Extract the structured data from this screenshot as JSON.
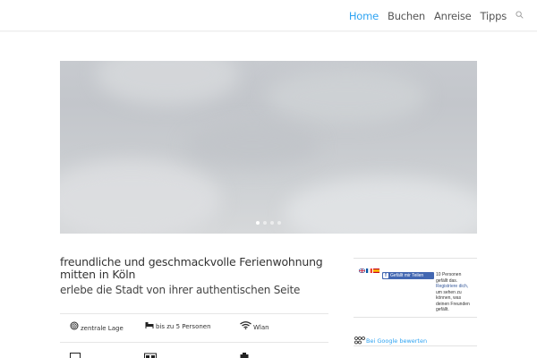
{
  "nav": {
    "items": [
      {
        "label": "Home",
        "active": true
      },
      {
        "label": "Buchen",
        "active": false
      },
      {
        "label": "Anreise",
        "active": false
      },
      {
        "label": "Tipps",
        "active": false
      }
    ],
    "search_icon": "search-icon",
    "active_color": "#2ea3f2"
  },
  "slider": {
    "slide_count": 4,
    "active_slide": 1
  },
  "main": {
    "title": "freundliche und geschmackvolle Ferienwohnung mitten in Köln",
    "subtitle": "erlebe die Stadt von ihrer authentischen Seite",
    "features": [
      {
        "icon": "location-icon",
        "label": "zentrale Lage"
      },
      {
        "icon": "bed-icon",
        "label": "bis zu 5 Personen"
      },
      {
        "icon": "wifi-icon",
        "label": "Wlan"
      }
    ],
    "bottom_icons": [
      "tv-icon",
      "kitchen-icon",
      "bag-icon"
    ]
  },
  "sidebar": {
    "flags": [
      "flag-uk-icon",
      "flag-fr-icon",
      "flag-es-icon"
    ],
    "fb_button": "Gefällt mir Teilen",
    "fb_count": "10 Personen gefällt das.",
    "fb_register": "Registriere dich,",
    "fb_rest": "um sehen zu können, was deinen Freunden gefällt.",
    "google_link": "Bei Google bewerten"
  }
}
